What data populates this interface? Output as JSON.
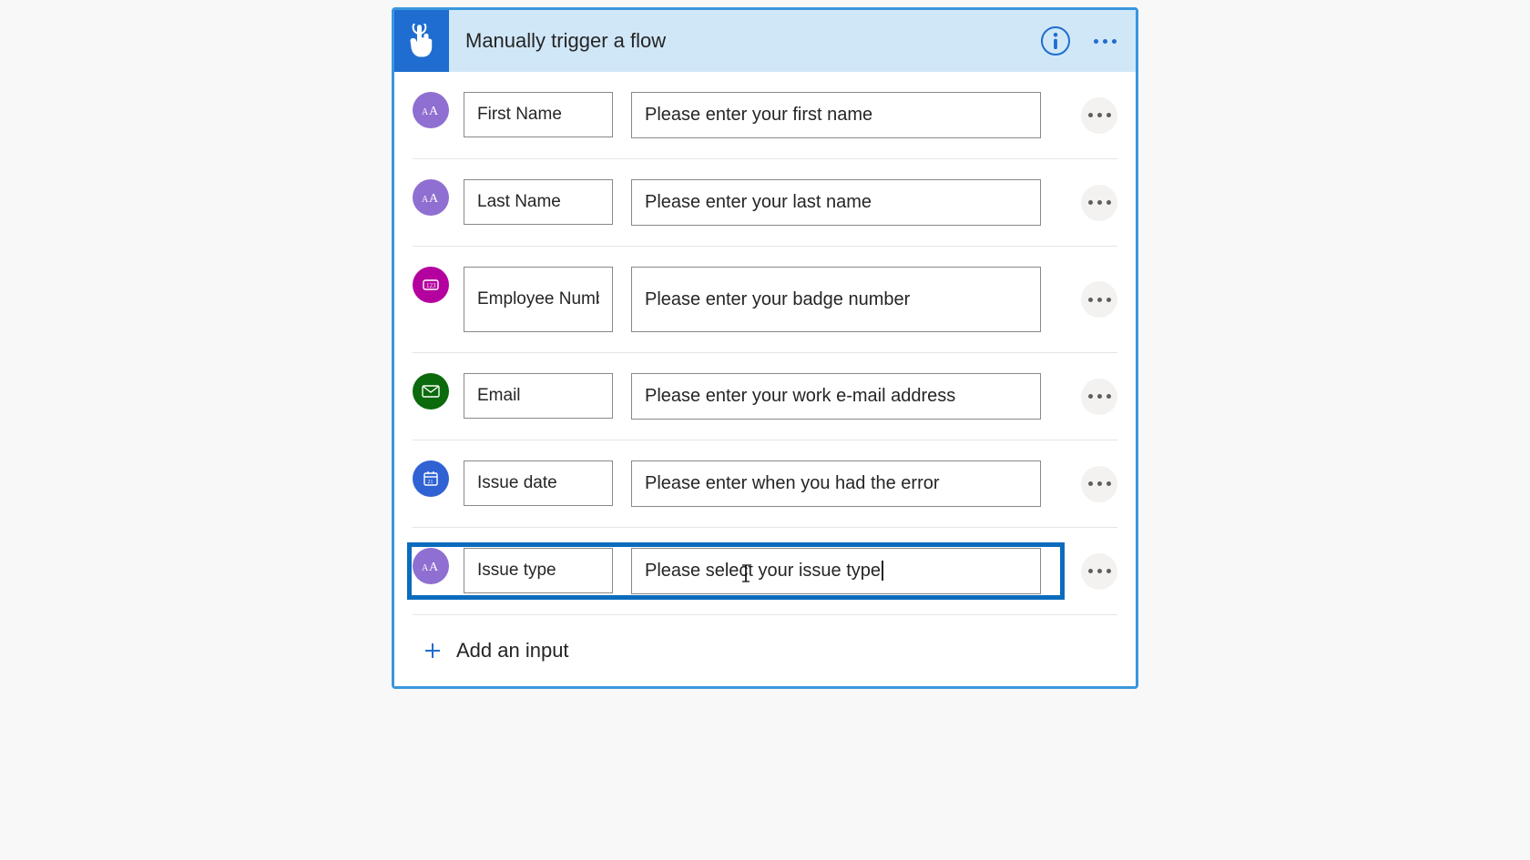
{
  "header": {
    "title": "Manually trigger a flow"
  },
  "inputs": [
    {
      "name": "First Name",
      "desc": "Please enter your first name",
      "type": "text"
    },
    {
      "name": "Last Name",
      "desc": "Please enter your last name",
      "type": "text"
    },
    {
      "name": "Employee Number",
      "desc": "Please enter your badge number",
      "type": "number"
    },
    {
      "name": "Email",
      "desc": "Please enter your work e-mail address",
      "type": "email"
    },
    {
      "name": "Issue date",
      "desc": "Please enter when you had the error",
      "type": "date"
    },
    {
      "name": "Issue type",
      "desc": "Please select your issue type",
      "type": "text",
      "highlighted": true,
      "editing": true
    }
  ],
  "add_label": "Add an input"
}
